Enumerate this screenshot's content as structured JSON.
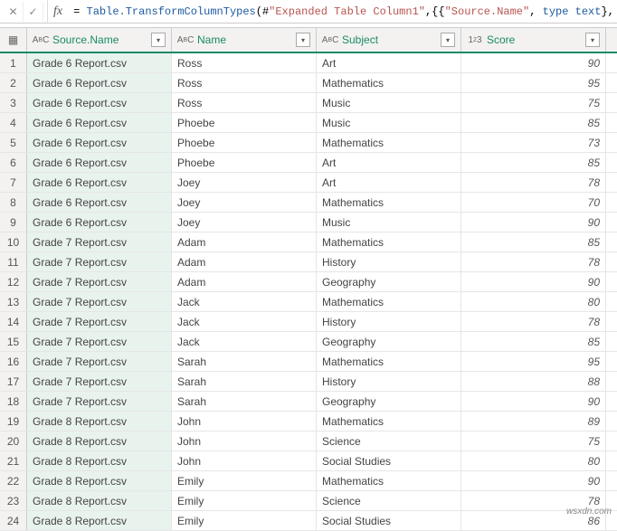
{
  "formula": {
    "eq": "= ",
    "p1": "Table.TransformColumnTypes",
    "p2": "(#",
    "p3": "\"Expanded Table Column1\"",
    "p4": ",{{",
    "p5": "\"Source.Name\"",
    "p6": ", ",
    "p7": "type text",
    "p8": "},"
  },
  "icons": {
    "fx": "fx",
    "cancel": "✕",
    "confirm": "✓",
    "dropdown": "▾",
    "table": "▦"
  },
  "headers": {
    "source": "Source.Name",
    "name": "Name",
    "subject": "Subject",
    "score": "Score",
    "abc_prefix": "A",
    "abc_sup": "B",
    "abc_suffix": "C",
    "num_prefix": "1",
    "num_sup": "2",
    "num_suffix": "3"
  },
  "rows": [
    {
      "n": "1",
      "source": "Grade 6 Report.csv",
      "name": "Ross",
      "subject": "Art",
      "score": "90"
    },
    {
      "n": "2",
      "source": "Grade 6 Report.csv",
      "name": "Ross",
      "subject": "Mathematics",
      "score": "95"
    },
    {
      "n": "3",
      "source": "Grade 6 Report.csv",
      "name": "Ross",
      "subject": "Music",
      "score": "75"
    },
    {
      "n": "4",
      "source": "Grade 6 Report.csv",
      "name": "Phoebe",
      "subject": "Music",
      "score": "85"
    },
    {
      "n": "5",
      "source": "Grade 6 Report.csv",
      "name": "Phoebe",
      "subject": "Mathematics",
      "score": "73"
    },
    {
      "n": "6",
      "source": "Grade 6 Report.csv",
      "name": "Phoebe",
      "subject": "Art",
      "score": "85"
    },
    {
      "n": "7",
      "source": "Grade 6 Report.csv",
      "name": "Joey",
      "subject": "Art",
      "score": "78"
    },
    {
      "n": "8",
      "source": "Grade 6 Report.csv",
      "name": "Joey",
      "subject": "Mathematics",
      "score": "70"
    },
    {
      "n": "9",
      "source": "Grade 6 Report.csv",
      "name": "Joey",
      "subject": "Music",
      "score": "90"
    },
    {
      "n": "10",
      "source": "Grade 7 Report.csv",
      "name": "Adam",
      "subject": "Mathematics",
      "score": "85"
    },
    {
      "n": "11",
      "source": "Grade 7 Report.csv",
      "name": "Adam",
      "subject": "History",
      "score": "78"
    },
    {
      "n": "12",
      "source": "Grade 7 Report.csv",
      "name": "Adam",
      "subject": "Geography",
      "score": "90"
    },
    {
      "n": "13",
      "source": "Grade 7 Report.csv",
      "name": "Jack",
      "subject": "Mathematics",
      "score": "80"
    },
    {
      "n": "14",
      "source": "Grade 7 Report.csv",
      "name": "Jack",
      "subject": "History",
      "score": "78"
    },
    {
      "n": "15",
      "source": "Grade 7 Report.csv",
      "name": "Jack",
      "subject": "Geography",
      "score": "85"
    },
    {
      "n": "16",
      "source": "Grade 7 Report.csv",
      "name": "Sarah",
      "subject": "Mathematics",
      "score": "95"
    },
    {
      "n": "17",
      "source": "Grade 7 Report.csv",
      "name": "Sarah",
      "subject": "History",
      "score": "88"
    },
    {
      "n": "18",
      "source": "Grade 7 Report.csv",
      "name": "Sarah",
      "subject": "Geography",
      "score": "90"
    },
    {
      "n": "19",
      "source": "Grade 8 Report.csv",
      "name": "John",
      "subject": "Mathematics",
      "score": "89"
    },
    {
      "n": "20",
      "source": "Grade 8 Report.csv",
      "name": "John",
      "subject": "Science",
      "score": "75"
    },
    {
      "n": "21",
      "source": "Grade 8 Report.csv",
      "name": "John",
      "subject": "Social Studies",
      "score": "80"
    },
    {
      "n": "22",
      "source": "Grade 8 Report.csv",
      "name": "Emily",
      "subject": "Mathematics",
      "score": "90"
    },
    {
      "n": "23",
      "source": "Grade 8 Report.csv",
      "name": "Emily",
      "subject": "Science",
      "score": "78"
    },
    {
      "n": "24",
      "source": "Grade 8 Report.csv",
      "name": "Emily",
      "subject": "Social Studies",
      "score": "86"
    }
  ],
  "watermark": "wsxdn.com"
}
